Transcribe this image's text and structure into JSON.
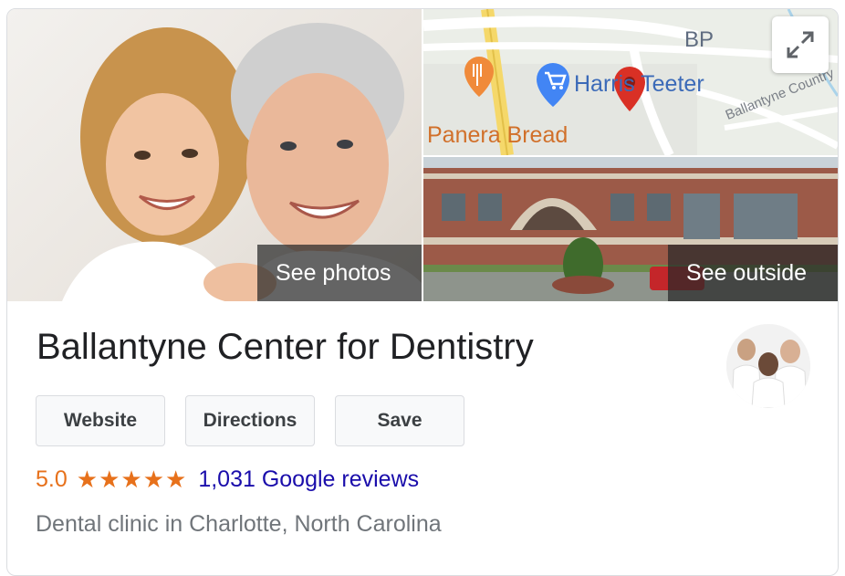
{
  "photos": {
    "main_label": "See photos",
    "outside_label": "See outside"
  },
  "map": {
    "labels": {
      "bp": "BP",
      "store": "Harris Teeter",
      "restaurant": "Panera Bread",
      "road": "Ballantyne Country"
    },
    "expand_icon": "expand-icon"
  },
  "business": {
    "name": "Ballantyne Center for Dentistry",
    "rating": "5.0",
    "stars": "★★★★★",
    "rating_value": 5,
    "rating_max": 5,
    "reviews_link": "1,031 Google reviews",
    "category": "Dental clinic in Charlotte, North Carolina"
  },
  "actions": {
    "website_label": "Website",
    "directions_label": "Directions",
    "save_label": "Save"
  },
  "colors": {
    "rating": "#e7711b",
    "link": "#1a0dab",
    "secondary_text": "#70757a",
    "map_pin": "#d93025"
  }
}
